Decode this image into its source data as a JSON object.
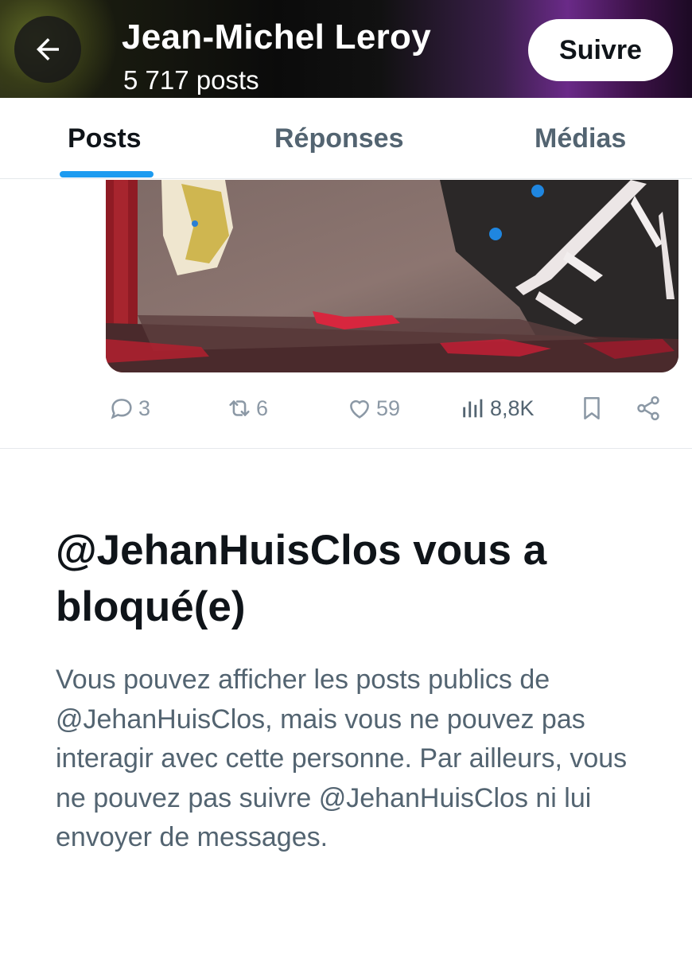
{
  "header": {
    "back_icon": "arrow-left-icon",
    "profile_name": "Jean-Michel Leroy",
    "post_count": "5 717 posts",
    "follow_label": "Suivre"
  },
  "tabs": [
    {
      "label": "Posts",
      "active": true
    },
    {
      "label": "Réponses",
      "active": false
    },
    {
      "label": "Médias",
      "active": false
    }
  ],
  "accent_color": "#1d9bf0",
  "post": {
    "media_description_icon": "painting-image",
    "actions": {
      "replies": "3",
      "reposts": "6",
      "likes": "59",
      "views": "8,8K"
    }
  },
  "blocked": {
    "title": "@JehanHuisClos vous a bloqué(e)",
    "body": "Vous pouvez afficher les posts publics de @JehanHuisClos, mais vous ne pouvez pas interagir avec cette personne. Par ailleurs, vous ne pouvez pas suivre @JehanHuisClos ni lui envoyer de messages."
  }
}
